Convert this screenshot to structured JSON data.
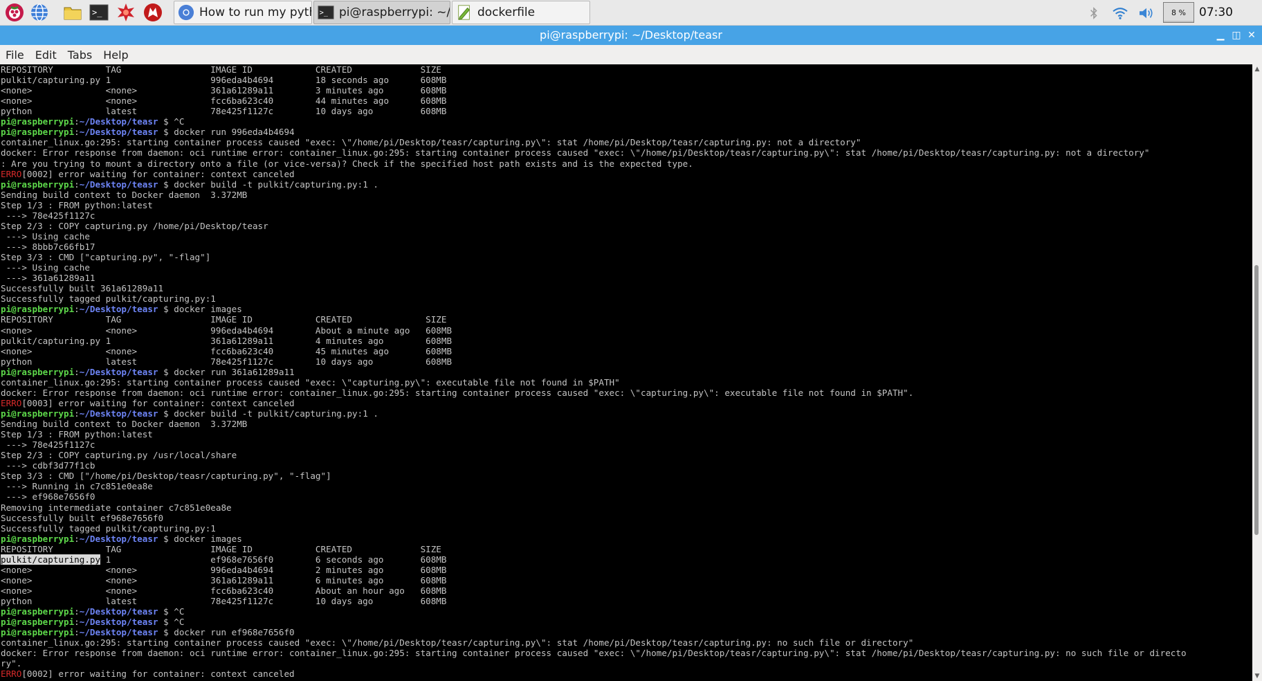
{
  "taskbar": {
    "launchers": [
      {
        "name": "menu-icon"
      },
      {
        "name": "web-browser-icon"
      },
      {
        "name": "file-manager-icon"
      },
      {
        "name": "terminal-icon"
      },
      {
        "name": "math-kernel-icon"
      },
      {
        "name": "wolfram-icon"
      }
    ],
    "tasks": [
      {
        "label": "How to run my pytho...",
        "icon": "chromium-icon",
        "active": false
      },
      {
        "label": "pi@raspberrypi: ~/De...",
        "icon": "terminal-icon",
        "active": true
      },
      {
        "label": "dockerfile",
        "icon": "text-editor-icon",
        "active": false
      }
    ],
    "tray": {
      "cpu_text": "8 %",
      "cpu_usage_percent": 8,
      "clock": "07:30"
    }
  },
  "window": {
    "title": "pi@raspberrypi: ~/Desktop/teasr",
    "controls": {
      "minimize": "▁",
      "maximize": "◫",
      "close": "✕"
    }
  },
  "menu": [
    "File",
    "Edit",
    "Tabs",
    "Help"
  ],
  "colors": {
    "prompt_user": "#5dd84a",
    "prompt_path": "#6d84f5",
    "error": "#d72a2a",
    "titlebar": "#47a3e6",
    "text": "#c4c4c4"
  },
  "prompt": {
    "user": "pi@raspberrypi",
    "sep": ":",
    "path": "~/Desktop/teasr",
    "sym": " $ "
  },
  "terminal": [
    {
      "type": "text",
      "text": "REPOSITORY          TAG                 IMAGE ID            CREATED             SIZE"
    },
    {
      "type": "text",
      "text": "pulkit/capturing.py 1                   996eda4b4694        18 seconds ago      608MB"
    },
    {
      "type": "text",
      "text": "<none>              <none>              361a61289a11        3 minutes ago       608MB"
    },
    {
      "type": "text",
      "text": "<none>              <none>              fcc6ba623c40        44 minutes ago      608MB"
    },
    {
      "type": "text",
      "text": "python              latest              78e425f1127c        10 days ago         608MB"
    },
    {
      "type": "prompt",
      "cmd": "^C"
    },
    {
      "type": "prompt",
      "cmd": "docker run 996eda4b4694"
    },
    {
      "type": "text",
      "text": "container_linux.go:295: starting container process caused \"exec: \\\"/home/pi/Desktop/teasr/capturing.py\\\": stat /home/pi/Desktop/teasr/capturing.py: not a directory\""
    },
    {
      "type": "text",
      "text": "docker: Error response from daemon: oci runtime error: container_linux.go:295: starting container process caused \"exec: \\\"/home/pi/Desktop/teasr/capturing.py\\\": stat /home/pi/Desktop/teasr/capturing.py: not a directory\""
    },
    {
      "type": "text",
      "text": ": Are you trying to mount a directory onto a file (or vice-versa)? Check if the specified host path exists and is the expected type."
    },
    {
      "type": "error",
      "tag": "ERRO",
      "text": "[0002] error waiting for container: context canceled"
    },
    {
      "type": "prompt",
      "cmd": "docker build -t pulkit/capturing.py:1 ."
    },
    {
      "type": "text",
      "text": "Sending build context to Docker daemon  3.372MB"
    },
    {
      "type": "text",
      "text": "Step 1/3 : FROM python:latest"
    },
    {
      "type": "text",
      "text": " ---> 78e425f1127c"
    },
    {
      "type": "text",
      "text": "Step 2/3 : COPY capturing.py /home/pi/Desktop/teasr"
    },
    {
      "type": "text",
      "text": " ---> Using cache"
    },
    {
      "type": "text",
      "text": " ---> 8bbb7c66fb17"
    },
    {
      "type": "text",
      "text": "Step 3/3 : CMD [\"capturing.py\", \"-flag\"]"
    },
    {
      "type": "text",
      "text": " ---> Using cache"
    },
    {
      "type": "text",
      "text": " ---> 361a61289a11"
    },
    {
      "type": "text",
      "text": "Successfully built 361a61289a11"
    },
    {
      "type": "text",
      "text": "Successfully tagged pulkit/capturing.py:1"
    },
    {
      "type": "prompt",
      "cmd": "docker images"
    },
    {
      "type": "text",
      "text": "REPOSITORY          TAG                 IMAGE ID            CREATED              SIZE"
    },
    {
      "type": "text",
      "text": "<none>              <none>              996eda4b4694        About a minute ago   608MB"
    },
    {
      "type": "text",
      "text": "pulkit/capturing.py 1                   361a61289a11        4 minutes ago        608MB"
    },
    {
      "type": "text",
      "text": "<none>              <none>              fcc6ba623c40        45 minutes ago       608MB"
    },
    {
      "type": "text",
      "text": "python              latest              78e425f1127c        10 days ago          608MB"
    },
    {
      "type": "prompt",
      "cmd": "docker run 361a61289a11"
    },
    {
      "type": "text",
      "text": "container_linux.go:295: starting container process caused \"exec: \\\"capturing.py\\\": executable file not found in $PATH\""
    },
    {
      "type": "text",
      "text": "docker: Error response from daemon: oci runtime error: container_linux.go:295: starting container process caused \"exec: \\\"capturing.py\\\": executable file not found in $PATH\"."
    },
    {
      "type": "error",
      "tag": "ERRO",
      "text": "[0003] error waiting for container: context canceled"
    },
    {
      "type": "prompt",
      "cmd": "docker build -t pulkit/capturing.py:1 ."
    },
    {
      "type": "text",
      "text": "Sending build context to Docker daemon  3.372MB"
    },
    {
      "type": "text",
      "text": "Step 1/3 : FROM python:latest"
    },
    {
      "type": "text",
      "text": " ---> 78e425f1127c"
    },
    {
      "type": "text",
      "text": "Step 2/3 : COPY capturing.py /usr/local/share"
    },
    {
      "type": "text",
      "text": " ---> cdbf3d77f1cb"
    },
    {
      "type": "text",
      "text": "Step 3/3 : CMD [\"/home/pi/Desktop/teasr/capturing.py\", \"-flag\"]"
    },
    {
      "type": "text",
      "text": " ---> Running in c7c851e0ea8e"
    },
    {
      "type": "text",
      "text": " ---> ef968e7656f0"
    },
    {
      "type": "text",
      "text": "Removing intermediate container c7c851e0ea8e"
    },
    {
      "type": "text",
      "text": "Successfully built ef968e7656f0"
    },
    {
      "type": "text",
      "text": "Successfully tagged pulkit/capturing.py:1"
    },
    {
      "type": "prompt",
      "cmd": "docker images"
    },
    {
      "type": "text",
      "text": "REPOSITORY          TAG                 IMAGE ID            CREATED             SIZE"
    },
    {
      "type": "selected",
      "sel": "pulkit/capturing.py",
      "text": " 1                   ef968e7656f0        6 seconds ago       608MB"
    },
    {
      "type": "text",
      "text": "<none>              <none>              996eda4b4694        2 minutes ago       608MB"
    },
    {
      "type": "text",
      "text": "<none>              <none>              361a61289a11        6 minutes ago       608MB"
    },
    {
      "type": "text",
      "text": "<none>              <none>              fcc6ba623c40        About an hour ago   608MB"
    },
    {
      "type": "text",
      "text": "python              latest              78e425f1127c        10 days ago         608MB"
    },
    {
      "type": "prompt",
      "cmd": "^C"
    },
    {
      "type": "prompt",
      "cmd": "^C"
    },
    {
      "type": "prompt",
      "cmd": "docker run ef968e7656f0"
    },
    {
      "type": "text",
      "text": "container_linux.go:295: starting container process caused \"exec: \\\"/home/pi/Desktop/teasr/capturing.py\\\": stat /home/pi/Desktop/teasr/capturing.py: no such file or directory\""
    },
    {
      "type": "text",
      "text": "docker: Error response from daemon: oci runtime error: container_linux.go:295: starting container process caused \"exec: \\\"/home/pi/Desktop/teasr/capturing.py\\\": stat /home/pi/Desktop/teasr/capturing.py: no such file or directo"
    },
    {
      "type": "text",
      "text": "ry\"."
    },
    {
      "type": "error",
      "tag": "ERRO",
      "text": "[0002] error waiting for container: context canceled"
    }
  ]
}
